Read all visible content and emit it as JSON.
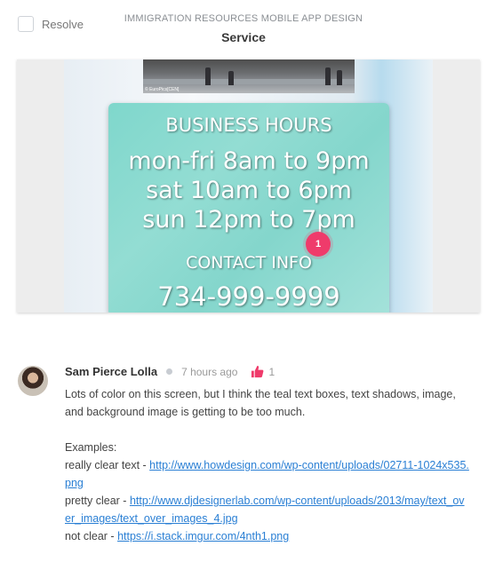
{
  "header": {
    "resolve_label": "Resolve",
    "project_title": "IMMIGRATION RESOURCES MOBILE APP DESIGN",
    "screen_title": "Service"
  },
  "preview": {
    "photo_caption": "© EuroPics[CEN]",
    "business_hours_title": "BUSINESS HOURS",
    "hours_line1": "mon-fri 8am to 9pm",
    "hours_line2": "sat 10am to 6pm",
    "hours_line3": "sun 12pm to 7pm",
    "contact_title": "CONTACT INFO",
    "phone": "734-999-9999",
    "pin_number": "1"
  },
  "comment": {
    "author": "Sam Pierce Lolla",
    "timestamp": "7 hours ago",
    "like_count": "1",
    "text1": "Lots of color on this screen, but I think the teal text boxes, text shadows, image, and background image is getting to be too much.",
    "examples_label": "Examples:",
    "ex1_label": "really clear text - ",
    "ex1_link": "http://www.howdesign.com/wp-content/uploads/02711-1024x535.png",
    "ex2_label": "pretty clear - ",
    "ex2_link": "http://www.djdesignerlab.com/wp-content/uploads/2013/may/text_over_images/text_over_images_4.jpg",
    "ex3_label": "not clear - ",
    "ex3_link": "https://i.stack.imgur.com/4nth1.png"
  },
  "colors": {
    "accent_pin": "#ef3b6b",
    "link": "#2a7fd4",
    "teal": "#84d6cc"
  }
}
